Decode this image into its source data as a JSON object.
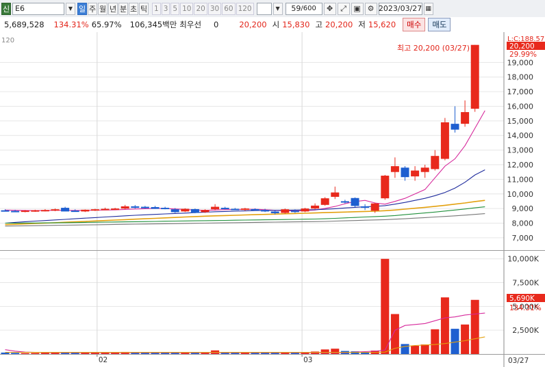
{
  "toolbar": {
    "market_tag": "신",
    "symbol": "E6",
    "periods": [
      "일",
      "주",
      "월",
      "년",
      "분",
      "초",
      "틱"
    ],
    "active_period": "일",
    "intervals": [
      "1",
      "3",
      "5",
      "10",
      "20",
      "30",
      "60",
      "120"
    ],
    "count_value": "59",
    "count_total": "/600",
    "date_value": "2023/03/27"
  },
  "info": {
    "volume": "5,689,528",
    "volume_change": "134.31%",
    "turnover_rate": "65.97%",
    "amount": "106,345백만",
    "priority_label": "최우선",
    "priority_value": "0",
    "close": "20,200",
    "open_label": "시",
    "open": "15,830",
    "high_label": "고",
    "high": "20,200",
    "low_label": "저",
    "low": "15,620",
    "buy_label": "매수",
    "sell_label": "매도"
  },
  "chart": {
    "ma_label": "120",
    "high_annotation": "최고 20,200 (03/27)",
    "price_badge": "20,200",
    "pct_badge": "29.99%",
    "limit_label": "L:C:188.57",
    "volume_badge": "5,690K",
    "volume_pct_badge": "134.31%",
    "x_labels": [
      "02",
      "03"
    ],
    "x_last": "03/27",
    "colors": {
      "up": "#e8291c",
      "down": "#1e5fd0",
      "ma5": "#d6289b",
      "ma20": "#1d2a9c",
      "ma60": "#e3a00e",
      "ma120": "#1e8f3a",
      "ma240": "#777777"
    }
  },
  "chart_data": {
    "type": "candlestick",
    "price_axis": {
      "ticks": [
        7000,
        8000,
        9000,
        10000,
        11000,
        12000,
        13000,
        14000,
        15000,
        16000,
        17000,
        18000,
        19000
      ],
      "tick_labels": [
        "7,000",
        "8,000",
        "9,000",
        "10,000",
        "11,000",
        "12,000",
        "13,000",
        "14,000",
        "15,000",
        "16,000",
        "17,000",
        "18,000",
        "19,000"
      ],
      "range": [
        6200,
        20700
      ]
    },
    "volume_axis": {
      "ticks": [
        2500,
        5000,
        7500,
        10000
      ],
      "tick_labels": [
        "2,500K",
        "5,000K",
        "7,500K",
        "10,000K"
      ],
      "range": [
        0,
        10700
      ]
    },
    "candles": [
      {
        "o": 8880,
        "h": 8950,
        "l": 8800,
        "c": 8850,
        "v": 150
      },
      {
        "o": 8840,
        "h": 8920,
        "l": 8780,
        "c": 8810,
        "v": 120
      },
      {
        "o": 8800,
        "h": 8900,
        "l": 8740,
        "c": 8860,
        "v": 100
      },
      {
        "o": 8830,
        "h": 8920,
        "l": 8770,
        "c": 8880,
        "v": 110
      },
      {
        "o": 8880,
        "h": 8960,
        "l": 8800,
        "c": 8900,
        "v": 130
      },
      {
        "o": 8880,
        "h": 9000,
        "l": 8820,
        "c": 8950,
        "v": 180
      },
      {
        "o": 9050,
        "h": 9120,
        "l": 8980,
        "c": 8800,
        "v": 160
      },
      {
        "o": 8860,
        "h": 8950,
        "l": 8780,
        "c": 8820,
        "v": 130
      },
      {
        "o": 8800,
        "h": 8940,
        "l": 8760,
        "c": 8920,
        "v": 140
      },
      {
        "o": 8880,
        "h": 8980,
        "l": 8830,
        "c": 8950,
        "v": 150
      },
      {
        "o": 8950,
        "h": 9060,
        "l": 8900,
        "c": 8980,
        "v": 170
      },
      {
        "o": 8990,
        "h": 9050,
        "l": 8930,
        "c": 9000,
        "v": 140
      },
      {
        "o": 9000,
        "h": 9250,
        "l": 8950,
        "c": 9150,
        "v": 220
      },
      {
        "o": 9150,
        "h": 9240,
        "l": 9000,
        "c": 9050,
        "v": 190
      },
      {
        "o": 9120,
        "h": 9180,
        "l": 9000,
        "c": 9020,
        "v": 170
      },
      {
        "o": 9100,
        "h": 9180,
        "l": 8980,
        "c": 8980,
        "v": 160
      },
      {
        "o": 9050,
        "h": 9120,
        "l": 8950,
        "c": 8960,
        "v": 150
      },
      {
        "o": 8950,
        "h": 9030,
        "l": 8700,
        "c": 8750,
        "v": 140
      },
      {
        "o": 8800,
        "h": 9020,
        "l": 8760,
        "c": 8980,
        "v": 130
      },
      {
        "o": 8960,
        "h": 9000,
        "l": 8680,
        "c": 8700,
        "v": 120
      },
      {
        "o": 8750,
        "h": 8950,
        "l": 8700,
        "c": 8900,
        "v": 110
      },
      {
        "o": 8950,
        "h": 9300,
        "l": 8880,
        "c": 9120,
        "v": 380
      },
      {
        "o": 9050,
        "h": 9120,
        "l": 8950,
        "c": 8980,
        "v": 200
      },
      {
        "o": 8980,
        "h": 9040,
        "l": 8900,
        "c": 8950,
        "v": 130
      },
      {
        "o": 8950,
        "h": 9050,
        "l": 8850,
        "c": 9000,
        "v": 140
      },
      {
        "o": 8960,
        "h": 9010,
        "l": 8860,
        "c": 8900,
        "v": 120
      },
      {
        "o": 8900,
        "h": 8980,
        "l": 8760,
        "c": 8800,
        "v": 110
      },
      {
        "o": 8800,
        "h": 8860,
        "l": 8600,
        "c": 8680,
        "v": 110
      },
      {
        "o": 8700,
        "h": 9000,
        "l": 8650,
        "c": 8950,
        "v": 150
      },
      {
        "o": 8850,
        "h": 8950,
        "l": 8700,
        "c": 8760,
        "v": 120
      },
      {
        "o": 8800,
        "h": 9050,
        "l": 8750,
        "c": 9000,
        "v": 160
      },
      {
        "o": 9000,
        "h": 9350,
        "l": 8950,
        "c": 9200,
        "v": 260
      },
      {
        "o": 9250,
        "h": 9780,
        "l": 9200,
        "c": 9700,
        "v": 480
      },
      {
        "o": 9800,
        "h": 10500,
        "l": 9650,
        "c": 10100,
        "v": 560
      },
      {
        "o": 9500,
        "h": 9600,
        "l": 9350,
        "c": 9480,
        "v": 320
      },
      {
        "o": 9720,
        "h": 9760,
        "l": 9100,
        "c": 9180,
        "v": 280
      },
      {
        "o": 9150,
        "h": 9300,
        "l": 8900,
        "c": 9050,
        "v": 200
      },
      {
        "o": 8850,
        "h": 9400,
        "l": 8700,
        "c": 9350,
        "v": 360
      },
      {
        "o": 9700,
        "h": 11300,
        "l": 9600,
        "c": 11250,
        "v": 10000
      },
      {
        "o": 11500,
        "h": 12500,
        "l": 11100,
        "c": 11900,
        "v": 4200
      },
      {
        "o": 11800,
        "h": 11900,
        "l": 10900,
        "c": 11150,
        "v": 1050
      },
      {
        "o": 11200,
        "h": 11900,
        "l": 10900,
        "c": 11600,
        "v": 860
      },
      {
        "o": 11500,
        "h": 12000,
        "l": 11100,
        "c": 11800,
        "v": 1000
      },
      {
        "o": 11700,
        "h": 13000,
        "l": 11600,
        "c": 12600,
        "v": 2600
      },
      {
        "o": 12400,
        "h": 15200,
        "l": 12300,
        "c": 14900,
        "v": 5950
      },
      {
        "o": 14800,
        "h": 16000,
        "l": 14200,
        "c": 14400,
        "v": 2650
      },
      {
        "o": 14800,
        "h": 16400,
        "l": 14600,
        "c": 15600,
        "v": 3100
      },
      {
        "o": 15830,
        "h": 20200,
        "l": 15620,
        "c": 20200,
        "v": 5690
      }
    ],
    "moving_averages": [
      {
        "name": "ma5",
        "values": [
          8900,
          8880,
          8870,
          8860,
          8870,
          8880,
          8880,
          8870,
          8880,
          8890,
          8900,
          8910,
          8940,
          8970,
          8990,
          9000,
          9000,
          8970,
          8940,
          8900,
          8880,
          8900,
          8920,
          8930,
          8940,
          8950,
          8920,
          8880,
          8860,
          8840,
          8860,
          8900,
          9010,
          9140,
          9330,
          9480,
          9560,
          9380,
          9300,
          9490,
          9700,
          10000,
          10300,
          11100,
          11900,
          12400,
          13300,
          14500,
          15700
        ]
      },
      {
        "name": "ma20",
        "values": [
          8000,
          8050,
          8100,
          8140,
          8180,
          8220,
          8260,
          8300,
          8340,
          8380,
          8420,
          8460,
          8500,
          8540,
          8570,
          8600,
          8630,
          8660,
          8690,
          8720,
          8750,
          8780,
          8800,
          8820,
          8840,
          8860,
          8870,
          8880,
          8890,
          8900,
          8910,
          8920,
          8950,
          8990,
          9040,
          9080,
          9120,
          9150,
          9200,
          9300,
          9420,
          9560,
          9700,
          9880,
          10100,
          10400,
          10800,
          11300,
          11650
        ]
      },
      {
        "name": "ma60",
        "values": [
          7900,
          7920,
          7950,
          7980,
          8000,
          8030,
          8060,
          8090,
          8120,
          8150,
          8180,
          8210,
          8240,
          8270,
          8300,
          8330,
          8360,
          8390,
          8420,
          8450,
          8480,
          8500,
          8520,
          8540,
          8560,
          8580,
          8600,
          8620,
          8640,
          8660,
          8680,
          8700,
          8720,
          8740,
          8760,
          8780,
          8800,
          8820,
          8850,
          8900,
          8960,
          9020,
          9080,
          9150,
          9220,
          9300,
          9380,
          9480,
          9560
        ]
      },
      {
        "name": "ma120",
        "values": [
          8000,
          8000,
          8010,
          8010,
          8020,
          8020,
          8030,
          8040,
          8050,
          8060,
          8070,
          8080,
          8090,
          8100,
          8110,
          8120,
          8130,
          8140,
          8150,
          8160,
          8170,
          8180,
          8190,
          8200,
          8210,
          8220,
          8230,
          8240,
          8250,
          8260,
          8270,
          8280,
          8300,
          8330,
          8360,
          8390,
          8420,
          8450,
          8480,
          8520,
          8580,
          8640,
          8700,
          8760,
          8830,
          8900,
          8970,
          9050,
          9120
        ]
      },
      {
        "name": "ma240",
        "values": [
          7800,
          7810,
          7820,
          7830,
          7840,
          7850,
          7860,
          7870,
          7880,
          7890,
          7900,
          7910,
          7920,
          7930,
          7940,
          7950,
          7960,
          7970,
          7980,
          7990,
          8000,
          8010,
          8020,
          8030,
          8040,
          8050,
          8060,
          8070,
          8080,
          8090,
          8100,
          8110,
          8120,
          8140,
          8160,
          8180,
          8200,
          8220,
          8240,
          8270,
          8300,
          8340,
          8380,
          8420,
          8460,
          8500,
          8550,
          8600,
          8650
        ]
      }
    ],
    "volume_averages": [
      {
        "name": "vma5",
        "values": [
          450,
          300,
          200,
          180,
          160,
          150,
          150,
          150,
          150,
          150,
          150,
          150,
          150,
          150,
          150,
          150,
          150,
          150,
          150,
          150,
          150,
          150,
          150,
          150,
          150,
          150,
          150,
          150,
          150,
          150,
          150,
          150,
          150,
          150,
          150,
          200,
          250,
          300,
          400,
          2500,
          3000,
          3100,
          3200,
          3500,
          3800,
          3900,
          4100,
          4200,
          4300
        ]
      },
      {
        "name": "vma20",
        "values": [
          180,
          180,
          180,
          170,
          170,
          170,
          170,
          170,
          170,
          170,
          170,
          170,
          170,
          170,
          170,
          170,
          170,
          170,
          170,
          170,
          170,
          170,
          170,
          170,
          170,
          170,
          170,
          170,
          170,
          170,
          170,
          170,
          170,
          170,
          170,
          170,
          170,
          180,
          200,
          600,
          800,
          900,
          950,
          1000,
          1100,
          1250,
          1400,
          1600,
          1800
        ]
      }
    ]
  }
}
